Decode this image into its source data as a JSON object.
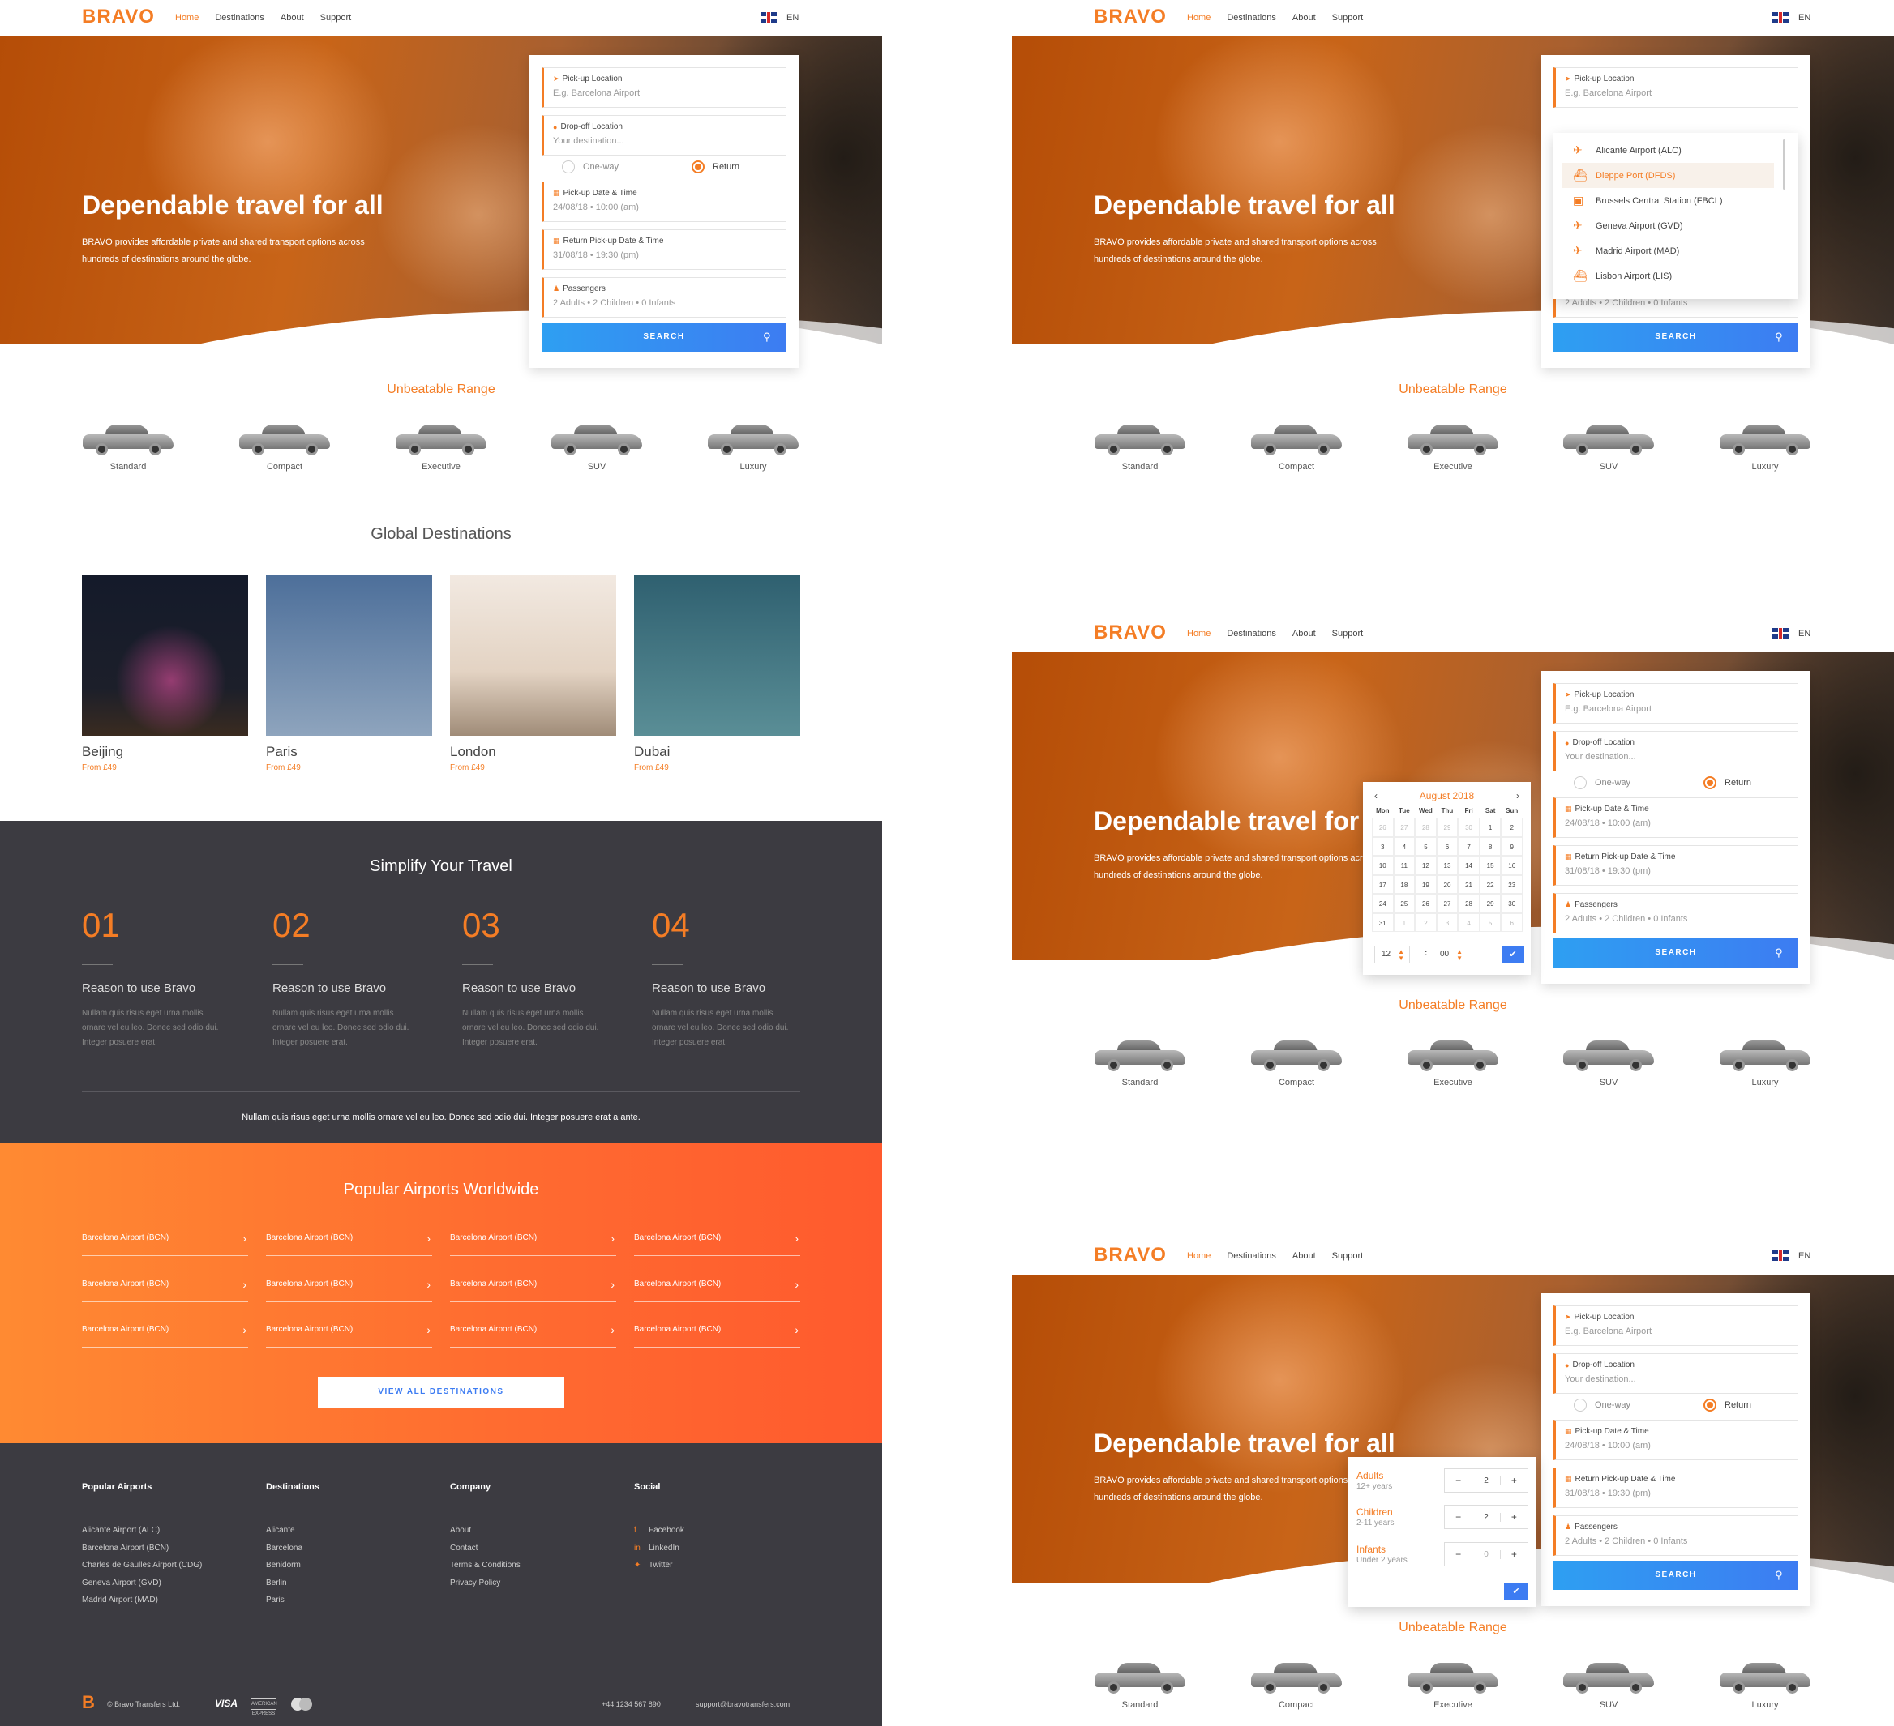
{
  "nav": {
    "logo": "BRAVO",
    "links": [
      "Home",
      "Destinations",
      "About",
      "Support"
    ],
    "lang": "EN"
  },
  "hero": {
    "title": "Dependable travel for all",
    "text": "BRAVO provides affordable private and shared transport options across hundreds of destinations around the globe."
  },
  "form": {
    "pickup_label": "Pick-up Location",
    "pickup_placeholder": "E.g. Barcelona Airport",
    "dropoff_label": "Drop-off Location",
    "dropoff_placeholder": "Your destination...",
    "oneway": "One-way",
    "return": "Return",
    "date_label": "Pick-up Date & Time",
    "date_value": "24/08/18 • 10:00 (am)",
    "return_label": "Return Pick-up Date & Time",
    "return_value": "31/08/18 • 19:30 (pm)",
    "pax_label": "Passengers",
    "pax_value": "2 Adults • 2 Children • 0 Infants",
    "search": "SEARCH"
  },
  "range": {
    "title": "Unbeatable Range",
    "cars": [
      "Standard",
      "Compact",
      "Executive",
      "SUV",
      "Luxury"
    ]
  },
  "destinations": {
    "title": "Global Destinations",
    "items": [
      {
        "name": "Beijing",
        "price": "From £49"
      },
      {
        "name": "Paris",
        "price": "From £49"
      },
      {
        "name": "London",
        "price": "From £49"
      },
      {
        "name": "Dubai",
        "price": "From £49"
      }
    ]
  },
  "simplify": {
    "title": "Simplify Your Travel",
    "reasons": [
      {
        "num": "01",
        "title": "Reason to use Bravo",
        "text": "Nullam quis risus eget urna mollis ornare vel eu leo. Donec sed odio dui. Integer posuere erat."
      },
      {
        "num": "02",
        "title": "Reason to use Bravo",
        "text": "Nullam quis risus eget urna mollis ornare vel eu leo. Donec sed odio dui. Integer posuere erat."
      },
      {
        "num": "03",
        "title": "Reason to use Bravo",
        "text": "Nullam quis risus eget urna mollis ornare vel eu leo. Donec sed odio dui. Integer posuere erat."
      },
      {
        "num": "04",
        "title": "Reason to use Bravo",
        "text": "Nullam quis risus eget urna mollis ornare vel eu leo. Donec sed odio dui. Integer posuere erat."
      }
    ],
    "footer": "Nullam quis risus eget urna mollis ornare vel eu leo. Donec sed odio dui. Integer posuere erat a ante."
  },
  "airports": {
    "title": "Popular Airports Worldwide",
    "items": [
      "Barcelona Airport (BCN)",
      "Barcelona Airport (BCN)",
      "Barcelona Airport (BCN)",
      "Barcelona Airport (BCN)",
      "Barcelona Airport (BCN)",
      "Barcelona Airport (BCN)",
      "Barcelona Airport (BCN)",
      "Barcelona Airport (BCN)",
      "Barcelona Airport (BCN)",
      "Barcelona Airport (BCN)",
      "Barcelona Airport (BCN)",
      "Barcelona Airport (BCN)"
    ],
    "button": "VIEW ALL DESTINATIONS"
  },
  "footer": {
    "cols": [
      {
        "head": "Popular Airports",
        "items": [
          "Alicante Airport (ALC)",
          "Barcelona Airport (BCN)",
          "Charles de Gaulles Airport (CDG)",
          "Geneva Airport (GVD)",
          "Madrid Airport (MAD)"
        ]
      },
      {
        "head": "Destinations",
        "items": [
          "Alicante",
          "Barcelona",
          "Benidorm",
          "Berlin",
          "Paris"
        ]
      },
      {
        "head": "Company",
        "items": [
          "About",
          "Contact",
          "Terms & Conditions",
          "Privacy Policy"
        ]
      },
      {
        "head": "Social",
        "items": [
          "Facebook",
          "LinkedIn",
          "Twitter"
        ]
      }
    ],
    "logo": "B",
    "copyright": "© Bravo Transfers Ltd.",
    "visa": "VISA",
    "amex": "AMERICAN EXPRESS",
    "phone": "+44 1234 567 890",
    "email": "support@bravotransfers.com"
  },
  "dropdown": {
    "items": [
      {
        "label": "Alicante Airport (ALC)",
        "icon": "plane-icon"
      },
      {
        "label": "Dieppe Port (DFDS)",
        "icon": "ferry-icon"
      },
      {
        "label": "Brussels Central Station (FBCL)",
        "icon": "train-icon"
      },
      {
        "label": "Geneva Airport (GVD)",
        "icon": "plane-icon"
      },
      {
        "label": "Madrid Airport (MAD)",
        "icon": "plane-icon"
      },
      {
        "label": "Lisbon Airport (LIS)",
        "icon": "ferry-icon"
      }
    ],
    "selected": 1
  },
  "calendar": {
    "month": "August 2018",
    "weekdays": [
      "Mon",
      "Tue",
      "Wed",
      "Thu",
      "Fri",
      "Sat",
      "Sun"
    ],
    "days": [
      "26",
      "27",
      "28",
      "29",
      "30",
      "1",
      "2",
      "3",
      "4",
      "5",
      "6",
      "7",
      "8",
      "9",
      "10",
      "11",
      "12",
      "13",
      "14",
      "15",
      "16",
      "17",
      "18",
      "19",
      "20",
      "21",
      "22",
      "23",
      "24",
      "25",
      "26",
      "27",
      "28",
      "29",
      "30",
      "31",
      "1",
      "2",
      "3",
      "4",
      "5",
      "6"
    ],
    "hour": "12",
    "minute": "00",
    "ok": "✔"
  },
  "passengers": {
    "rows": [
      {
        "label": "Adults",
        "sub": "12+ years",
        "value": "2"
      },
      {
        "label": "Children",
        "sub": "2-11 years",
        "value": "2"
      },
      {
        "label": "Infants",
        "sub": "Under 2 years",
        "value": "0"
      }
    ],
    "ok": "✔"
  },
  "colors": {
    "accent": "#f47d25",
    "blue": "#3d7cf2",
    "dark": "#3c3b41"
  }
}
